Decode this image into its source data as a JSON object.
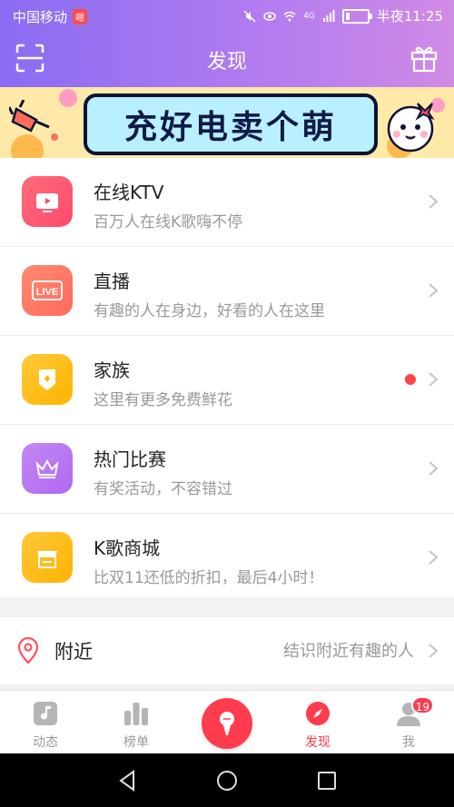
{
  "status_bar": {
    "carrier": "中国移动",
    "carrier_badge": "嗯",
    "time": "半夜11:25",
    "network": "4G",
    "battery_level": 0.2
  },
  "header": {
    "title": "发现",
    "left_icon": "scan-icon",
    "right_icon": "gift-icon"
  },
  "banner": {
    "title": "充好电卖个萌"
  },
  "features": [
    {
      "title": "在线KTV",
      "subtitle": "百万人在线K歌嗨不停",
      "icon": "tv-play-icon",
      "color": "#ff4b6a",
      "color2": "#ff6b7d",
      "red_dot": false
    },
    {
      "title": "直播",
      "subtitle": "有趣的人在身边，好看的人在这里",
      "icon": "live-icon",
      "color": "#ff6a5c",
      "color2": "#ff8a70",
      "red_dot": false
    },
    {
      "title": "家族",
      "subtitle": "这里有更多免费鲜花",
      "icon": "shield-icon",
      "color": "#ffb400",
      "color2": "#ffc93a",
      "red_dot": true
    },
    {
      "title": "热门比赛",
      "subtitle": "有奖活动，不容错过",
      "icon": "crown-icon",
      "color": "#b068f0",
      "color2": "#c288f4",
      "red_dot": false
    },
    {
      "title": "K歌商城",
      "subtitle": "比双11还低的折扣，最后4小时！",
      "icon": "shop-icon",
      "color": "#ffb200",
      "color2": "#ffc83a",
      "red_dot": false
    }
  ],
  "nearby": {
    "title": "附近",
    "hint": "结识附近有趣的人"
  },
  "tabbar": {
    "tabs": [
      {
        "label": "动态",
        "icon": "music-note-icon",
        "active": false
      },
      {
        "label": "榜单",
        "icon": "chart-icon",
        "active": false
      },
      {
        "label": "发现",
        "icon": "compass-icon",
        "active": true
      },
      {
        "label": "我",
        "icon": "person-icon",
        "active": false
      }
    ],
    "center_icon": "microphone-icon",
    "me_badge": "19"
  },
  "colors": {
    "accent": "#ff3c4e",
    "header_start": "#8a6cf2",
    "header_end": "#d08be6"
  }
}
